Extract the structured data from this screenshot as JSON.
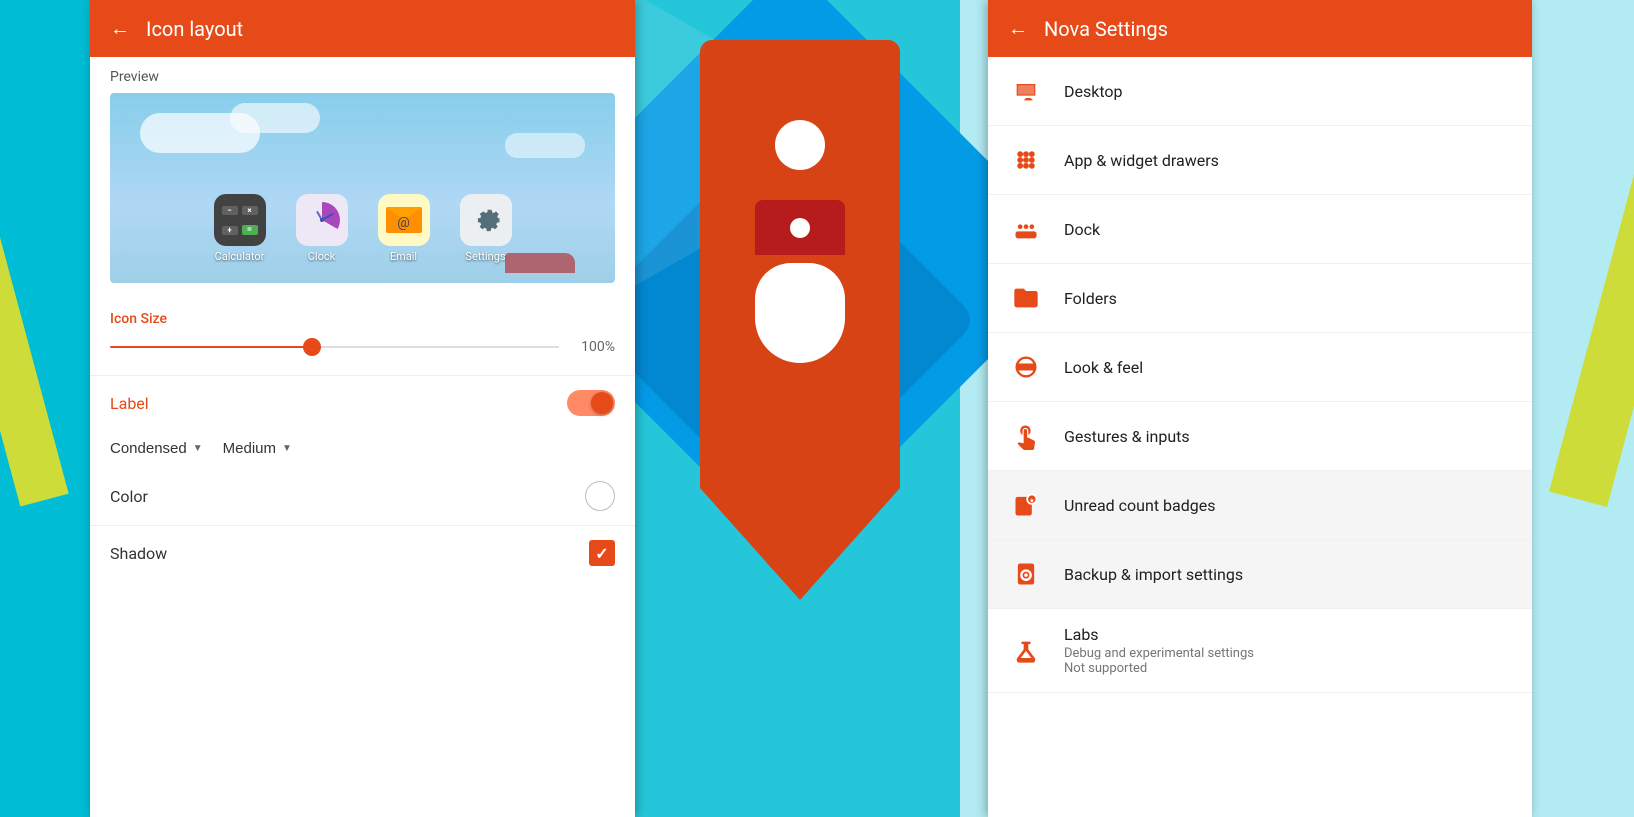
{
  "leftPanel": {
    "title": "Icon layout",
    "backArrow": "←",
    "preview": {
      "label": "Preview",
      "icons": [
        {
          "name": "Calculator",
          "type": "calculator"
        },
        {
          "name": "Clock",
          "type": "clock"
        },
        {
          "name": "Email",
          "type": "email"
        },
        {
          "name": "Settings",
          "type": "settings"
        }
      ]
    },
    "iconSize": {
      "label": "Icon Size",
      "value": "100%"
    },
    "label": {
      "label": "Label",
      "enabled": true
    },
    "dropdowns": {
      "style": "Condensed",
      "size": "Medium"
    },
    "color": {
      "label": "Color"
    },
    "shadow": {
      "label": "Shadow",
      "checked": true
    }
  },
  "rightPanel": {
    "title": "Nova Settings",
    "backArrow": "←",
    "items": [
      {
        "id": "desktop",
        "title": "Desktop",
        "icon": "desktop-icon"
      },
      {
        "id": "app-drawers",
        "title": "App & widget drawers",
        "icon": "grid-icon"
      },
      {
        "id": "dock",
        "title": "Dock",
        "icon": "dock-icon"
      },
      {
        "id": "folders",
        "title": "Folders",
        "icon": "folders-icon"
      },
      {
        "id": "look-feel",
        "title": "Look & feel",
        "icon": "look-icon"
      },
      {
        "id": "gestures",
        "title": "Gestures & inputs",
        "icon": "gestures-icon"
      },
      {
        "id": "unread-badges",
        "title": "Unread count badges",
        "icon": "badge-icon"
      },
      {
        "id": "backup",
        "title": "Backup & import settings",
        "icon": "backup-icon"
      },
      {
        "id": "labs",
        "title": "Labs",
        "subtitle": "Debug and experimental settings\nNot supported",
        "icon": "labs-icon"
      }
    ]
  }
}
